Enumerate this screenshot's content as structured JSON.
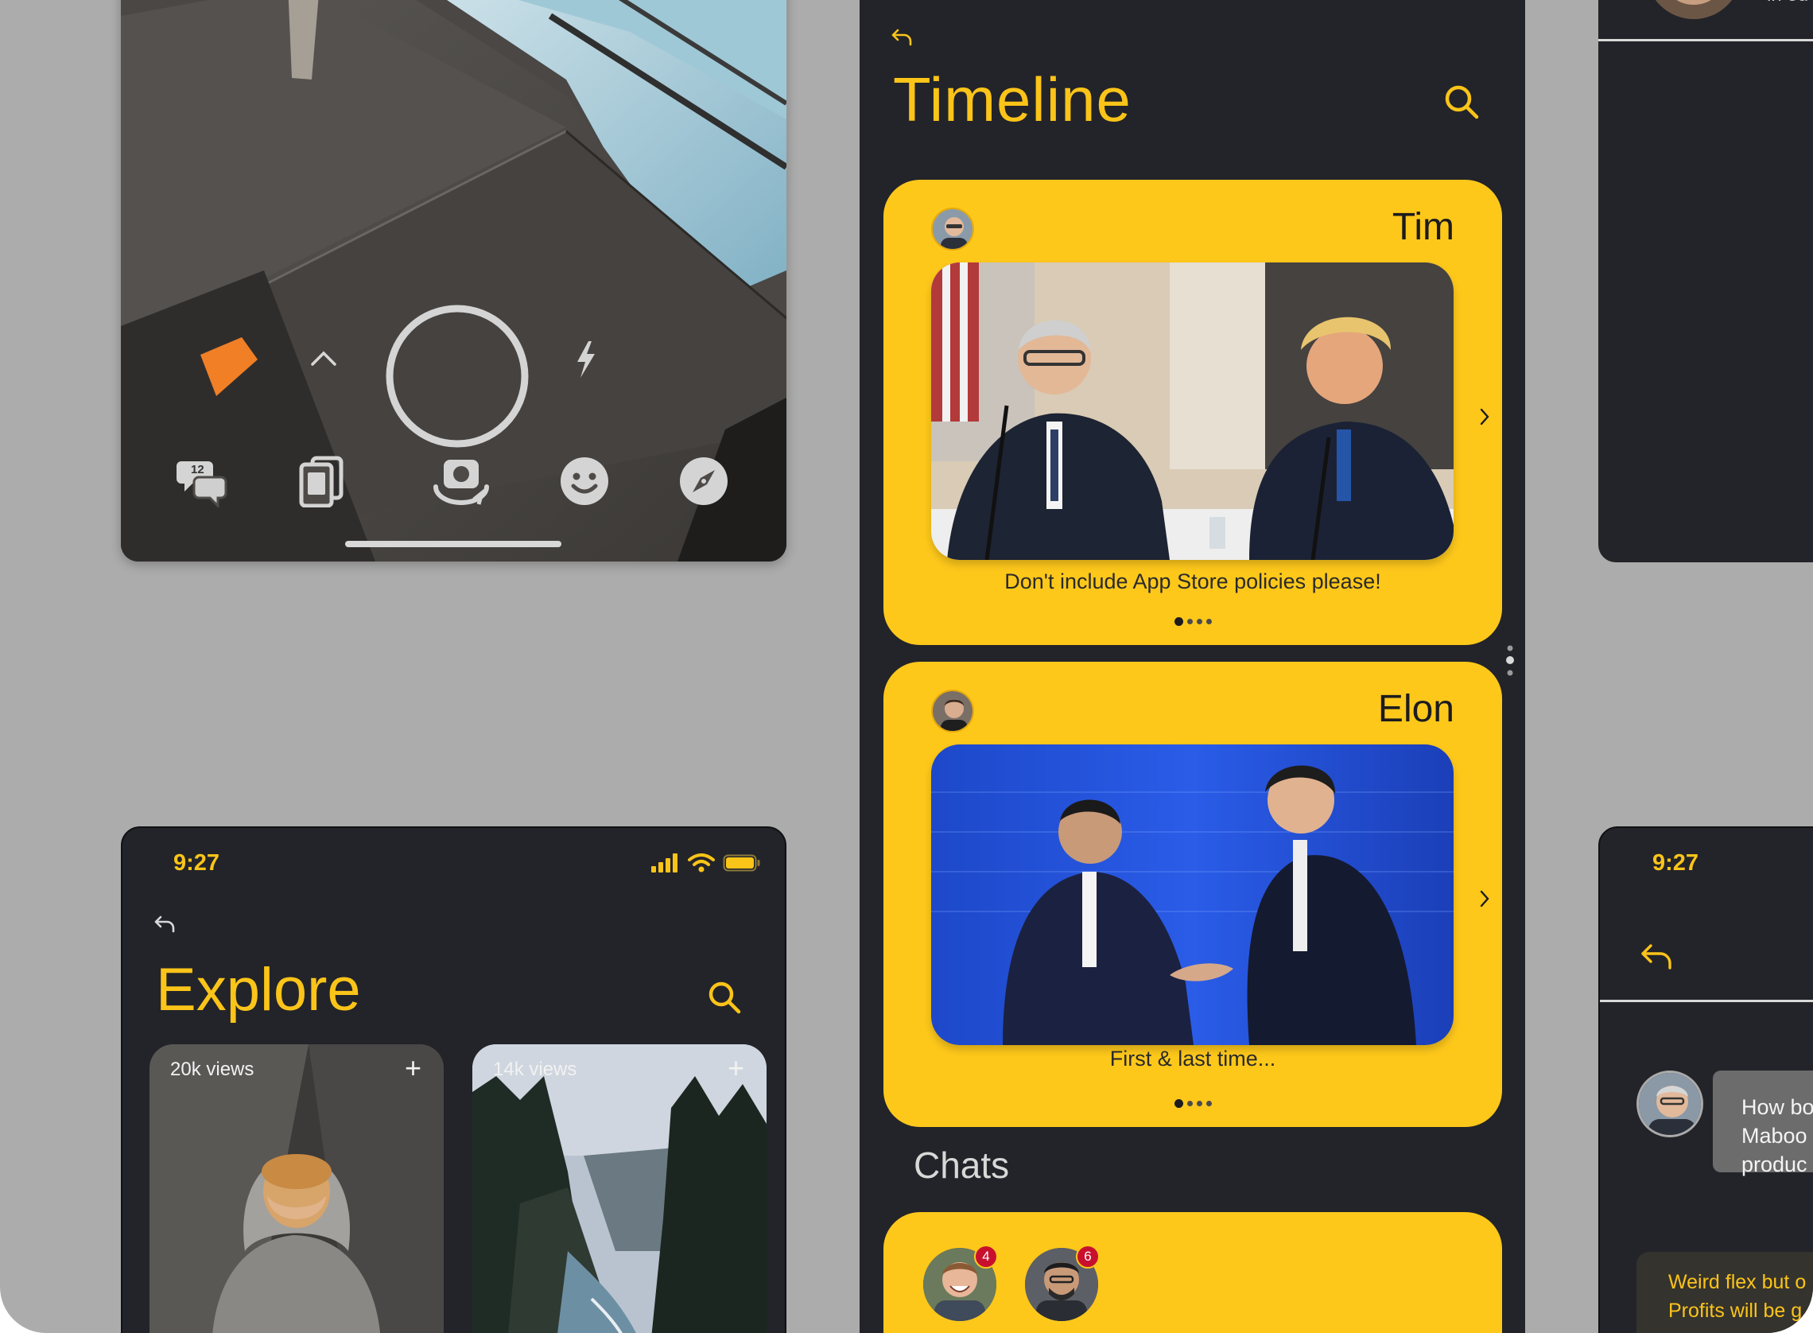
{
  "colors": {
    "accent": "#fbc419",
    "card": "#fec81b",
    "screen_bg": "#232429",
    "canvas_bg": "#acacac",
    "badge": "#c8102e"
  },
  "camera": {
    "story_badge_count": "12",
    "controls": [
      "chat-bubbles-icon",
      "chevron-up-icon",
      "shutter-button",
      "flash-icon",
      "gallery-icon",
      "flip-camera-icon",
      "emoji-icon",
      "compass-icon"
    ]
  },
  "timeline": {
    "title": "Timeline",
    "posts": [
      {
        "name": "Tim",
        "caption": "Don't include App Store policies please!",
        "page_index": 1,
        "page_count": 4
      },
      {
        "name": "Elon",
        "caption": "First & last time...",
        "page_index": 1,
        "page_count": 4
      }
    ],
    "chats_title": "Chats",
    "chats": [
      {
        "badge": "4"
      },
      {
        "badge": "6"
      }
    ]
  },
  "explore": {
    "time": "9:27",
    "title": "Explore",
    "tiles": [
      {
        "views": "20k views",
        "plus": "+"
      },
      {
        "views": "14k views",
        "plus": "+"
      }
    ]
  },
  "peek_top": {
    "text": "in ou"
  },
  "peek_bottom": {
    "time": "9:27",
    "message_in": "How bo\nMaboo\nproduc",
    "message_out": "Weird flex but o\nProfits will be g\nsomeone woul"
  }
}
